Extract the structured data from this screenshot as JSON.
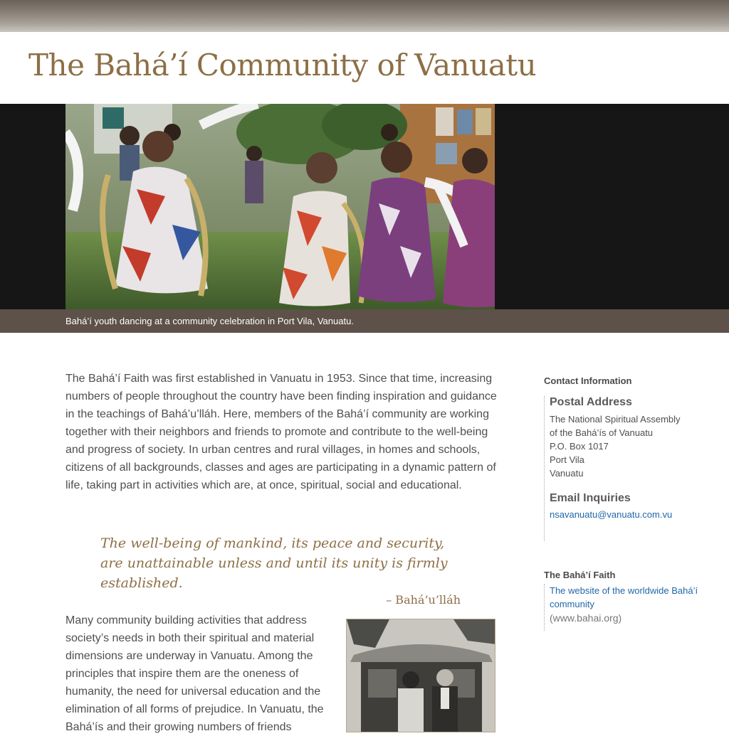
{
  "site": {
    "title": "The Bahá’í Community of Vanuatu"
  },
  "hero": {
    "caption": "Bahá’í youth dancing at a community celebration in Port Vila, Vanuatu."
  },
  "main": {
    "intro_paragraph": "The Bahá’í Faith was first established in Vanuatu in 1953. Since that time, increasing numbers of people throughout the country have been finding inspiration and guidance in the teachings of Bahá’u’lláh. Here, members of the Bahá’í community are working together with their neighbors and friends to promote and contribute to the well-being and progress of society. In urban centres and rural villages, in homes and schools, citizens of all backgrounds, classes and ages are participating in a dynamic pattern of life, taking part in activities which are, at once, spiritual, social and educational.",
    "quote_text": "The well-being of mankind, its peace and security, are unattainable unless and until its unity is firmly established.",
    "quote_attribution": "– Bahá’u’lláh",
    "second_paragraph": "Many community building activities that address society’s needs in both their spiritual and material dimensions are underway in Vanuatu. Among the principles that inspire them are the oneness of humanity, the need for universal education and the elimination of all forms of prejudice. In Vanuatu, the Bahá’ís and their growing numbers of friends"
  },
  "sidebar": {
    "contact_heading": "Contact Information",
    "postal_heading": "Postal Address",
    "address_lines": [
      "The National Spiritual Assembly",
      "of the Bahá’ís of Vanuatu",
      "P.O. Box 1017",
      "Port Vila",
      "Vanuatu"
    ],
    "email_heading": "Email Inquiries",
    "email": "nsavanuatu@vanuatu.com.vu",
    "faith_heading": "The Bahá’í Faith",
    "faith_link_text": "The website of the worldwide Bahá’í community",
    "faith_url": "(www.bahai.org)"
  },
  "colors": {
    "title_gold": "#8d6f45",
    "caption_bar": "#5d5149",
    "link_blue": "#1f67a8"
  }
}
